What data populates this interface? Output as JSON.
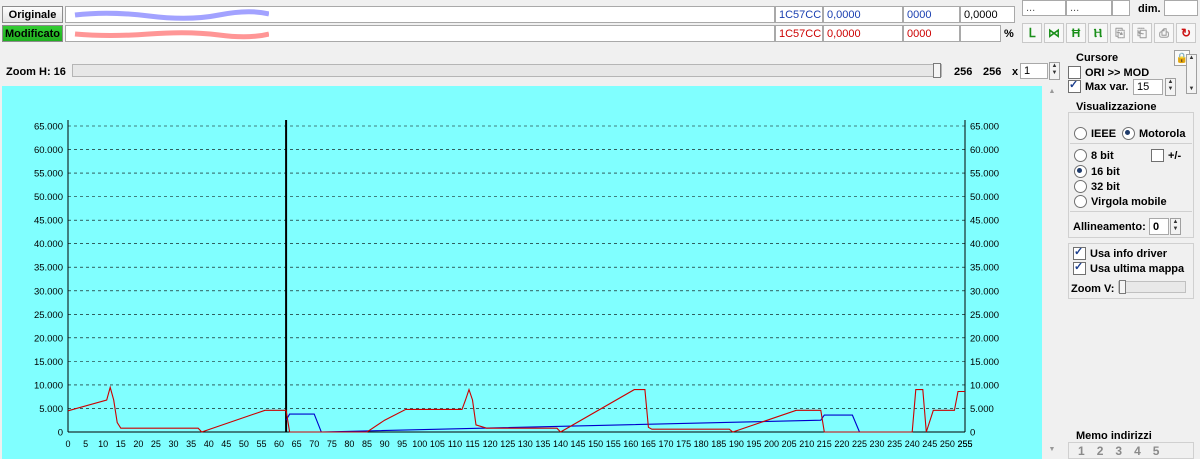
{
  "rows": {
    "originale": {
      "label": "Originale",
      "address": "1C57CC",
      "value_dec": "0,0000",
      "value_hex": "0000",
      "value4": "0,0000"
    },
    "modificato": {
      "label": "Modificato",
      "address": "1C57CC",
      "value_dec": "0,0000",
      "value_hex": "0000",
      "value4": "",
      "percent_sign": "%"
    }
  },
  "top_right": {
    "dim_label": "dim.",
    "field1": "...",
    "field2": "..."
  },
  "toolbar_icons": [
    "ori-icon",
    "mod-icon",
    "diff-icon",
    "dual-icon",
    "copy-icon",
    "paste-icon",
    "import-icon",
    "refresh-icon"
  ],
  "zoom_h": {
    "label": "Zoom H: 16",
    "value_a": "256",
    "value_b": "256",
    "mult_label": "x",
    "mult_value": "1",
    "level": 1.0
  },
  "cursore": {
    "title": "Cursore",
    "ori_mod": "ORI >> MOD",
    "ori_mod_checked": false,
    "max_var_label": "Max var.",
    "max_var_checked": true,
    "max_var_value": "15"
  },
  "visualizzazione": {
    "title": "Visualizzazione",
    "endian": [
      {
        "label": "IEEE",
        "selected": false
      },
      {
        "label": "Motorola",
        "selected": true
      }
    ],
    "sizes": [
      {
        "label": "8 bit",
        "selected": false
      },
      {
        "label": "16 bit",
        "selected": true
      },
      {
        "label": "32 bit",
        "selected": false
      },
      {
        "label": "Virgola mobile",
        "selected": false
      }
    ],
    "sign_label": "+/-",
    "sign_checked": false,
    "allineamento_label": "Allineamento:",
    "allineamento_value": "0",
    "usa_info_driver": "Usa info driver",
    "usa_info_driver_checked": true,
    "usa_ultima_mappa": "Usa ultima mappa",
    "usa_ultima_mappa_checked": true,
    "zoom_v": "Zoom V:",
    "zoom_v_level": 0.0
  },
  "memo": {
    "title": "Memo indirizzi",
    "slots": [
      "1",
      "2",
      "3",
      "4",
      "5"
    ]
  },
  "chart_data": {
    "type": "line",
    "y_ticks": [
      "0",
      "5.000",
      "10.000",
      "15.000",
      "20.000",
      "25.000",
      "30.000",
      "35.000",
      "40.000",
      "45.000",
      "50.000",
      "55.000",
      "60.000",
      "65.000"
    ],
    "ylim": [
      0,
      65000
    ],
    "xlim": [
      0,
      255
    ],
    "x_tick_step": 5,
    "cursor_x": 62,
    "grid": true,
    "colors": {
      "background": "#80ffff",
      "modified": "#cc0000",
      "original": "#0000cc",
      "cursor": "#000000",
      "grid": "#000000"
    },
    "series": [
      {
        "role": "original",
        "color": "#0000cc",
        "points": [
          [
            62,
            2500
          ],
          [
            63,
            3800
          ],
          [
            70,
            3800
          ],
          [
            72,
            0
          ],
          [
            214,
            2500
          ],
          [
            215,
            3600
          ],
          [
            223,
            3600
          ],
          [
            225,
            0
          ]
        ]
      },
      {
        "role": "modified",
        "color": "#cc0000",
        "points": [
          [
            0,
            4500
          ],
          [
            11,
            6800
          ],
          [
            12,
            9500
          ],
          [
            13,
            6800
          ],
          [
            14,
            2000
          ],
          [
            15,
            800
          ],
          [
            37,
            800
          ],
          [
            38,
            0
          ],
          [
            56,
            4600
          ],
          [
            62,
            4600
          ],
          [
            63,
            0
          ],
          [
            85,
            0
          ],
          [
            90,
            2500
          ],
          [
            96,
            4800
          ],
          [
            112,
            4800
          ],
          [
            113,
            6800
          ],
          [
            114,
            9000
          ],
          [
            115,
            6800
          ],
          [
            116,
            1500
          ],
          [
            119,
            800
          ],
          [
            139,
            800
          ],
          [
            140,
            0
          ],
          [
            161,
            9000
          ],
          [
            164,
            9000
          ],
          [
            165,
            1000
          ],
          [
            166,
            600
          ],
          [
            188,
            600
          ],
          [
            189,
            0
          ],
          [
            207,
            4600
          ],
          [
            214,
            4600
          ],
          [
            215,
            0
          ],
          [
            240,
            0
          ],
          [
            241,
            9000
          ],
          [
            243,
            9000
          ],
          [
            244,
            0
          ],
          [
            246,
            4600
          ],
          [
            252,
            4600
          ],
          [
            253,
            8600
          ],
          [
            255,
            8600
          ]
        ]
      }
    ]
  }
}
